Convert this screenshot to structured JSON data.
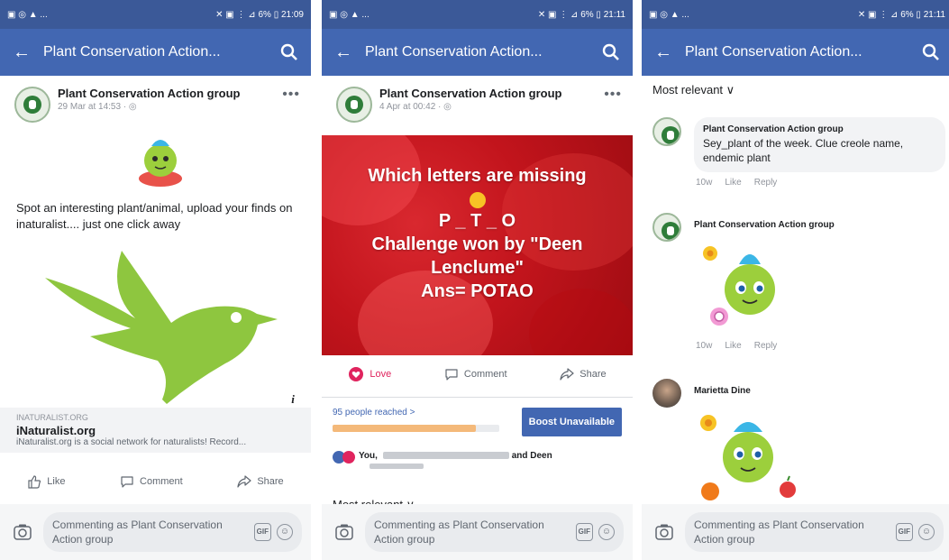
{
  "screens": [
    {
      "status": {
        "left": "▣ ◎ ▲ ...",
        "right": "✕ ▣ ⋮ ⊿ 6% ▯ 21:09"
      },
      "appbar": {
        "title": "Plant Conservation Action..."
      },
      "post": {
        "author": "Plant Conservation Action group",
        "time": "29 Mar at 14:53 · ◎",
        "text": "Spot an interesting plant/animal, upload your finds on inaturalist.... just one click away",
        "link": {
          "domain": "INATURALIST.ORG",
          "title": "iNaturalist.org",
          "description": "iNaturalist.org is a social network for naturalists! Record..."
        },
        "actions": {
          "like": "Like",
          "comment": "Comment",
          "share": "Share"
        }
      },
      "comment_bar": {
        "placeholder": "Commenting as Plant Conservation Action group",
        "gif": "GIF"
      }
    },
    {
      "status": {
        "left": "▣ ◎ ▲ ...",
        "right": "✕ ▣ ⋮ ⊿ 6% ▯ 21:11"
      },
      "appbar": {
        "title": "Plant Conservation Action..."
      },
      "post": {
        "author": "Plant Conservation Action group",
        "time": "4 Apr at 00:42 · ◎",
        "card_lines": [
          "Which letters are missing",
          "P _ T _ O",
          "Challenge won by \"Deen",
          "Lenclume\"",
          "Ans= POTAO"
        ],
        "actions": {
          "love": "Love",
          "comment": "Comment",
          "share": "Share"
        },
        "reach": "95 people reached >",
        "reach_fraction": 0.86,
        "boost": "Boost Unavailable",
        "reactors": "You, ",
        "reactors_end": "and Deen",
        "most_relevant": "Most relevant ∨"
      },
      "comment_bar": {
        "placeholder": "Commenting as Plant Conservation Action group",
        "gif": "GIF"
      }
    },
    {
      "status": {
        "left": "▣ ◎ ▲ ...",
        "right": "✕ ▣ ⋮ ⊿ 6% ▯ 21:11"
      },
      "appbar": {
        "title": "Plant Conservation Action..."
      },
      "most_relevant": "Most relevant ∨",
      "comments": [
        {
          "name": "Plant Conservation Action group",
          "text": "Sey_plant of the week. Clue creole name, endemic plant",
          "age": "10w",
          "like": "Like",
          "reply": "Reply"
        },
        {
          "name": "Plant Conservation Action group",
          "age": "10w",
          "like": "Like",
          "reply": "Reply"
        },
        {
          "name": "Marietta Dine"
        }
      ],
      "comment_bar": {
        "placeholder": "Commenting as Plant Conservation Action group",
        "gif": "GIF"
      }
    }
  ],
  "colors": {
    "facebook_blue": "#4267b2",
    "status_blue": "#3b5998",
    "love_red": "#e0245e",
    "inat_green": "#8ec63f"
  }
}
